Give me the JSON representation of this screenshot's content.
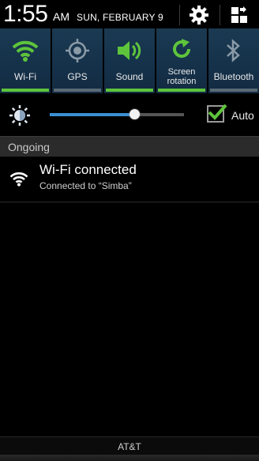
{
  "status": {
    "time": "1:55",
    "ampm": "AM",
    "date": "SUN, FEBRUARY 9"
  },
  "header_buttons": {
    "settings_icon": "gear-icon",
    "edit_icon": "grid-edit-icon"
  },
  "toggles": [
    {
      "label": "Wi-Fi",
      "icon": "wifi-icon",
      "state": "on"
    },
    {
      "label": "GPS",
      "icon": "gps-icon",
      "state": "off"
    },
    {
      "label": "Sound",
      "icon": "speaker-icon",
      "state": "on"
    },
    {
      "label_line1": "Screen",
      "label_line2": "rotation",
      "icon": "rotate-icon",
      "state": "on"
    },
    {
      "label": "Bluetooth",
      "icon": "bluetooth-icon",
      "state": "off"
    }
  ],
  "brightness": {
    "icon": "brightness-icon",
    "level": 0.63,
    "auto_label": "Auto",
    "auto_checked": true
  },
  "ongoing": {
    "section_title": "Ongoing",
    "notification": {
      "icon": "wifi-icon",
      "title": "Wi-Fi connected",
      "text": "Connected to “Simba”"
    }
  },
  "footer": {
    "carrier": "AT&T"
  },
  "colors": {
    "on": "#5ec43c",
    "off": "#5a6a76",
    "toggle_bg": "#15314a",
    "slider_fill": "#3b8fd4"
  }
}
